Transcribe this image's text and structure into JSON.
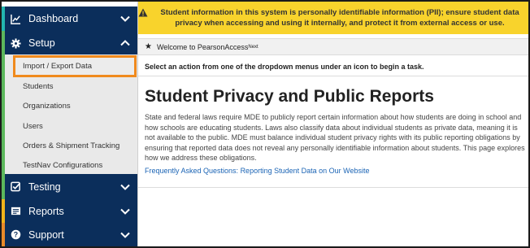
{
  "sidebar": {
    "dashboard": {
      "label": "Dashboard",
      "icon": "line-chart-icon"
    },
    "setup": {
      "label": "Setup",
      "icon": "gear-icon",
      "items": [
        {
          "label": "Import / Export Data",
          "selected": true
        },
        {
          "label": "Students"
        },
        {
          "label": "Organizations"
        },
        {
          "label": "Users"
        },
        {
          "label": "Orders & Shipment Tracking"
        },
        {
          "label": "TestNav Configurations"
        }
      ]
    },
    "testing": {
      "label": "Testing",
      "icon": "checkbox-icon"
    },
    "reports": {
      "label": "Reports",
      "icon": "report-icon"
    },
    "support": {
      "label": "Support",
      "icon": "question-icon"
    }
  },
  "banner": {
    "text": "Student information in this system is personally identifiable information (PII); ensure student data privacy when accessing and using it internally, and protect it from external access or use.",
    "color": "#f8d32c"
  },
  "welcome": {
    "text": "Welcome to PearsonAccess",
    "superscript": "Next"
  },
  "instruction": "Select an action from one of the dropdown menus under an icon to begin a task.",
  "page": {
    "title": "Student Privacy and Public Reports",
    "body": "State and federal laws require MDE to publicly report certain information about how students are doing in school and how schools are educating students. Laws also classify data about individual students as private data, meaning it is not available to the public. MDE must balance individual student privacy rights with its public reporting obligations by ensuring that reported data does not reveal any personally identifiable information about students. This page explores how we address these obligations.",
    "faq_link": "Frequently Asked Questions: Reporting Student Data on Our Website"
  },
  "colors": {
    "nav": "#0b2e5b",
    "highlight": "#f08a1d",
    "link": "#1b64b5"
  }
}
